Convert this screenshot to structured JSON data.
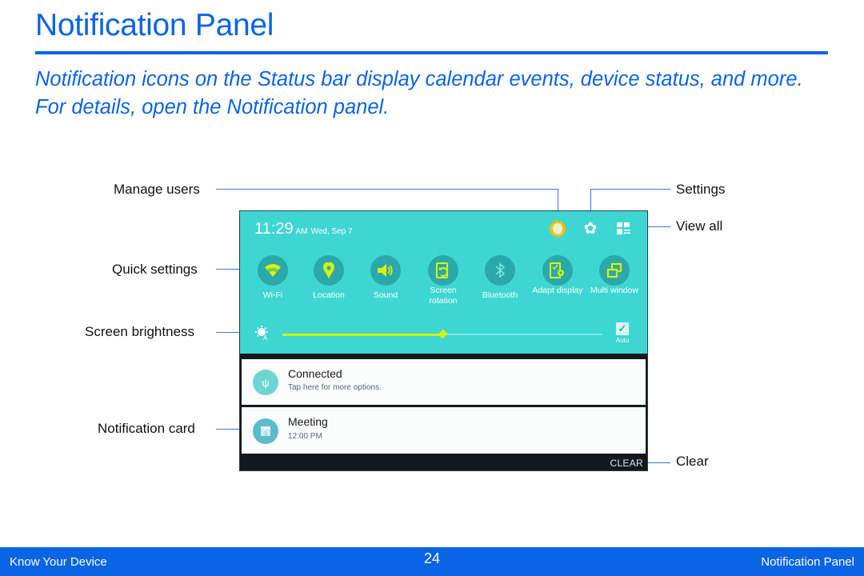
{
  "page": {
    "title": "Notification Panel",
    "intro": "Notification icons on the Status bar display calendar events, device status, and more. For details, open the Notification panel.",
    "accent_color": "#0a64e6"
  },
  "callouts": {
    "manage_users": "Manage users",
    "quick_settings": "Quick settings",
    "screen_brightness": "Screen brightness",
    "notification_card": "Notification card",
    "settings": "Settings",
    "view_all": "View all",
    "clear": "Clear"
  },
  "panel": {
    "time": "11:29",
    "ampm": "AM",
    "date": "Wed, Sep 7",
    "header_icons": [
      "user-avatar-icon",
      "settings-gear-icon",
      "view-all-grid-icon"
    ],
    "quick_settings": [
      {
        "label": "Wi-Fi",
        "icon": "wifi-icon"
      },
      {
        "label": "Location",
        "icon": "location-pin-icon"
      },
      {
        "label": "Sound",
        "icon": "speaker-icon"
      },
      {
        "label": "Screen rotation",
        "icon": "screen-rotation-icon"
      },
      {
        "label": "Bluetooth",
        "icon": "bluetooth-icon"
      },
      {
        "label": "Adapt display",
        "icon": "adapt-display-icon"
      },
      {
        "label": "Multi window",
        "icon": "multi-window-icon"
      }
    ],
    "brightness": {
      "level_percent": 50,
      "auto_label": "Auto",
      "auto_checked": true
    },
    "notifications": [
      {
        "title": "Connected",
        "subtitle": "Tap here for more options.",
        "icon": "usb-icon"
      },
      {
        "title": "Meeting",
        "subtitle": "12:00 PM",
        "icon": "calendar-icon"
      }
    ],
    "clear_label": "CLEAR",
    "colors": {
      "quick_panel_bg": "#3ed6d2",
      "active_icon": "#d7f20b"
    }
  },
  "footer": {
    "left": "Know Your Device",
    "page_number": "24",
    "right": "Notification Panel"
  }
}
